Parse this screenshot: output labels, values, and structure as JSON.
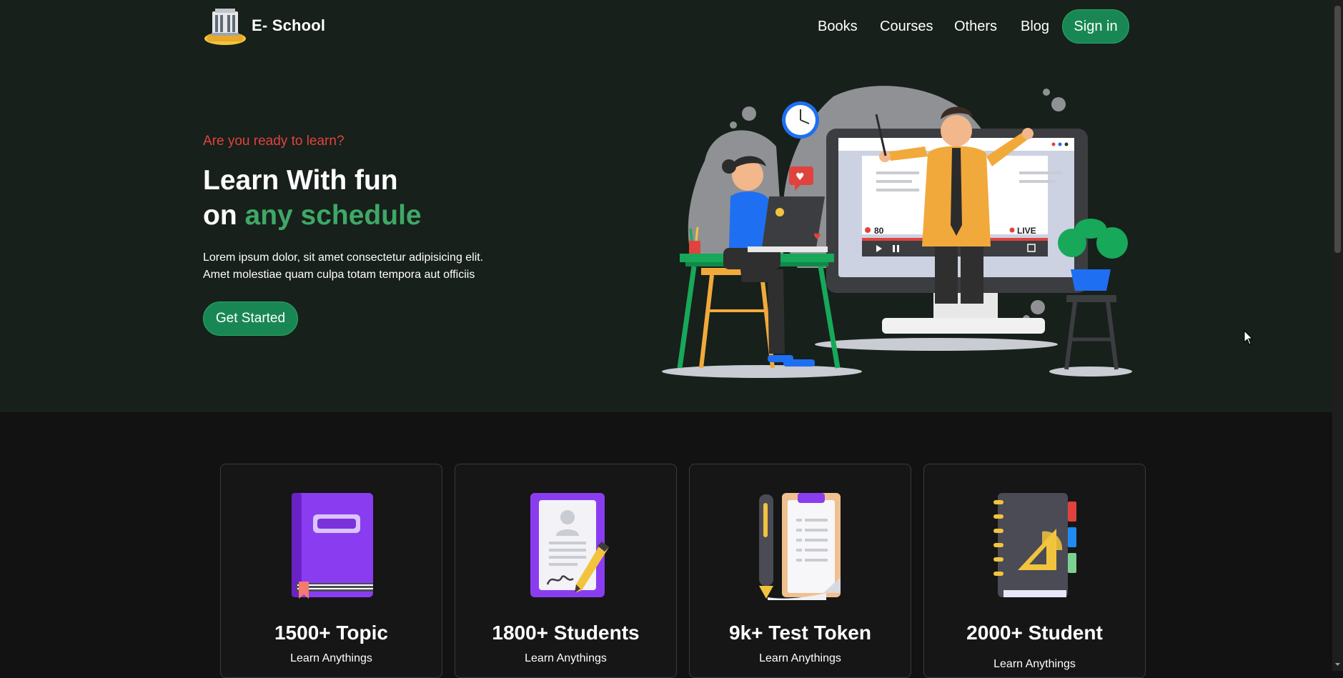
{
  "nav": {
    "brand": "E- School",
    "links": [
      "Books",
      "Courses",
      "Others",
      "Blog"
    ],
    "signin_label": "Sign in"
  },
  "hero": {
    "eyebrow": "Are you ready to learn?",
    "headline_line1": "Learn With fun",
    "headline_on": "on",
    "headline_accent": "any schedule",
    "lede_line1": "Lorem ipsum dolor, sit amet consectetur adipisicing elit.",
    "lede_line2": "Amet molestiae quam culpa totam tempora aut officiis",
    "cta_label": "Get Started",
    "illustration_labels": {
      "viewers": "80",
      "live": "LIVE"
    }
  },
  "stats": [
    {
      "value": "1500+ Topic",
      "caption": "Learn Anythings",
      "icon": "purple-book-icon"
    },
    {
      "value": "1800+ Students",
      "caption": "Learn Anythings",
      "icon": "certificate-pen-icon"
    },
    {
      "value": "9k+ Test Token",
      "caption": "Learn Anythings",
      "icon": "test-paper-pen-icon"
    },
    {
      "value": "2000+ Student",
      "caption": "Learn Anythings",
      "icon": "notebook-ruler-icon"
    }
  ],
  "colors": {
    "hero_bg": "#17201b",
    "page_bg": "#121212",
    "accent_green": "#198754",
    "headline_accent": "#3fa867",
    "eyebrow_red": "#e0433e"
  }
}
